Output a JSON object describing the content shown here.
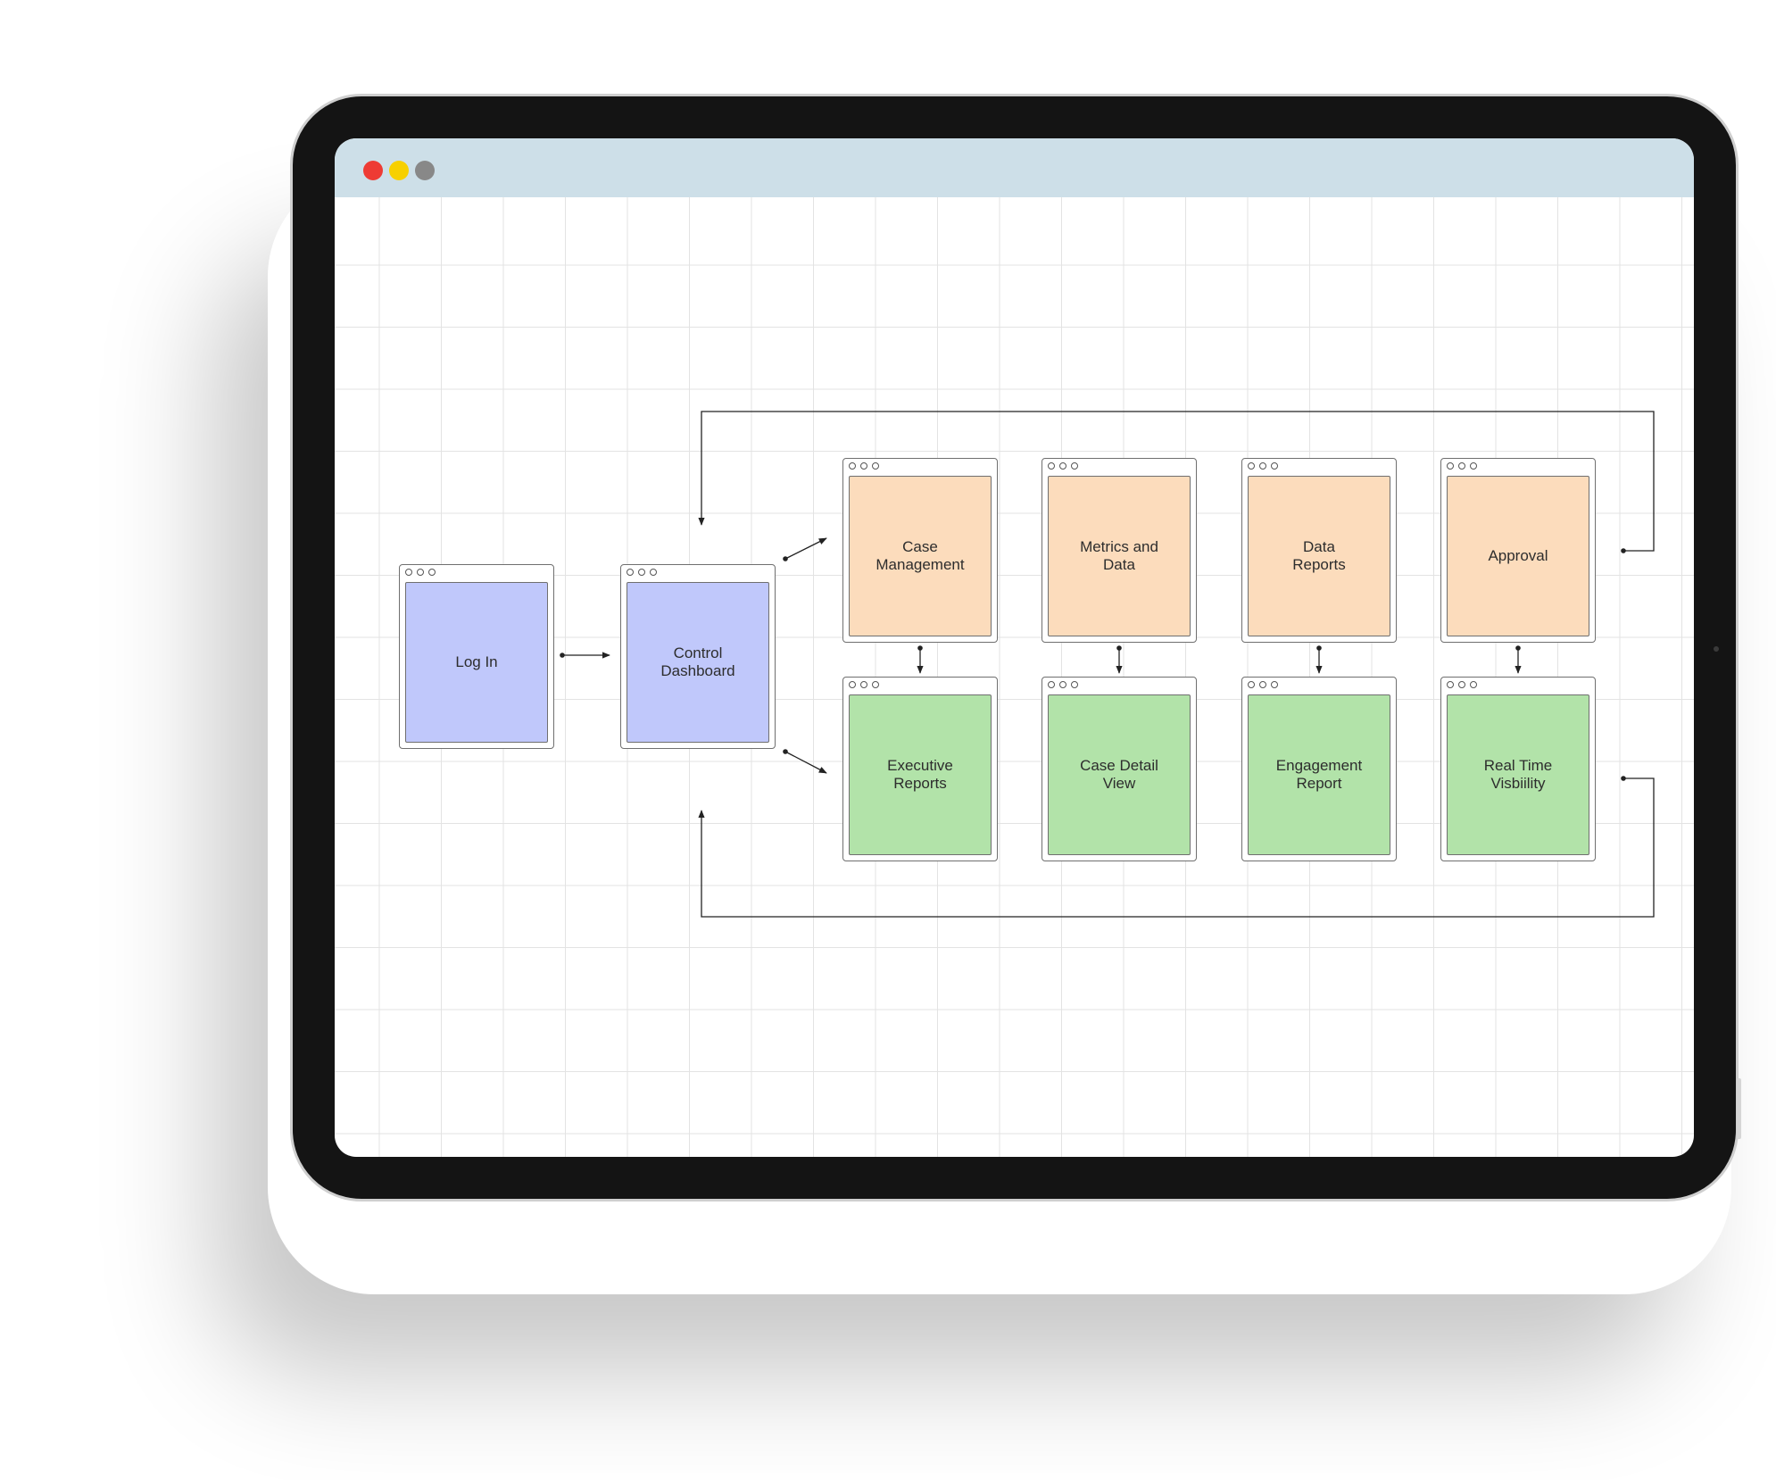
{
  "window": {
    "controls": [
      {
        "name": "close",
        "color": "#ee3b34"
      },
      {
        "name": "minimize",
        "color": "#f7d000"
      },
      {
        "name": "zoom",
        "color": "#888888"
      }
    ]
  },
  "colors": {
    "blue": "#c0c8fb",
    "orange": "#fcdcbc",
    "green": "#b2e3a9"
  },
  "nodes": [
    {
      "id": "log-in",
      "label": "Log In",
      "color": "blue"
    },
    {
      "id": "control-dashboard",
      "label": "Control\nDashboard",
      "color": "blue"
    },
    {
      "id": "case-management",
      "label": "Case\nManagement",
      "color": "orange"
    },
    {
      "id": "metrics-and-data",
      "label": "Metrics and\nData",
      "color": "orange"
    },
    {
      "id": "data-reports",
      "label": "Data\nReports",
      "color": "orange"
    },
    {
      "id": "approval",
      "label": "Approval",
      "color": "orange"
    },
    {
      "id": "executive-reports",
      "label": "Executive\nReports",
      "color": "green"
    },
    {
      "id": "case-detail-view",
      "label": "Case Detail\nView",
      "color": "green"
    },
    {
      "id": "engagement-report",
      "label": "Engagement\nReport",
      "color": "green"
    },
    {
      "id": "real-time-visibility",
      "label": "Real Time\nVisbiility",
      "color": "green"
    }
  ],
  "edges": [
    {
      "from": "log-in",
      "to": "control-dashboard",
      "type": "one-way"
    },
    {
      "from": "control-dashboard",
      "to": "case-management",
      "type": "one-way"
    },
    {
      "from": "control-dashboard",
      "to": "executive-reports",
      "type": "one-way"
    },
    {
      "from": "case-management",
      "to": "executive-reports",
      "type": "two-way"
    },
    {
      "from": "metrics-and-data",
      "to": "case-detail-view",
      "type": "two-way"
    },
    {
      "from": "data-reports",
      "to": "engagement-report",
      "type": "two-way"
    },
    {
      "from": "approval",
      "to": "real-time-visibility",
      "type": "two-way"
    },
    {
      "from": "approval",
      "to": "control-dashboard",
      "type": "loop-back"
    },
    {
      "from": "real-time-visibility",
      "to": "control-dashboard",
      "type": "loop-back"
    }
  ]
}
